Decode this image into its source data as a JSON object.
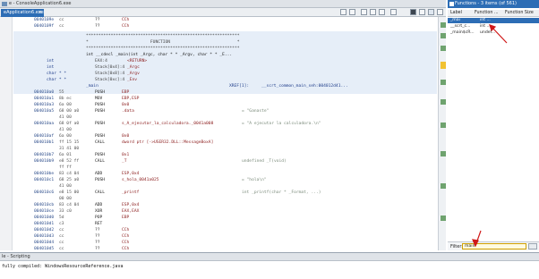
{
  "listing": {
    "title": "e - ConsoleApplication6.exe",
    "tab_label": "eApplication6.exe",
    "tab_close": "×",
    "lines": [
      {
        "addr": "0040109e",
        "bytes": "cc",
        "mn": "??",
        "op": "CCh",
        "cmt": ""
      },
      {
        "addr": "0040109f",
        "bytes": "cc",
        "mn": "??",
        "op": "CCh",
        "cmt": ""
      }
    ],
    "header_box": {
      "top_border": "**************************************************************",
      "function_line": "*                         FUNCTION                           *",
      "bottom_border": "**************************************************************",
      "signature": "int __cdecl _main(int _Argc, char * * _Argv, char * * _E...",
      "params": [
        {
          "type": "int",
          "loc": "EAX:4",
          "name": "<RETURN>"
        },
        {
          "type": "int",
          "loc": "Stack[0x4]:4",
          "name": "_Argc"
        },
        {
          "type": "char * *",
          "loc": "Stack[0x8]:4",
          "name": "_Argv"
        },
        {
          "type": "char * *",
          "loc": "Stack[0xc]:4",
          "name": "_Env"
        }
      ],
      "label": "_main",
      "xref": "XREF[1]:     __scrt_common_main_seh:004012d41..."
    },
    "body": [
      {
        "addr": "004010a0",
        "bytes": "55",
        "mn": "PUSH",
        "op": "EBP",
        "cmt": ""
      },
      {
        "addr": "004010a1",
        "bytes": "8b ec",
        "mn": "MOV",
        "op": "EBP,ESP",
        "cmt": ""
      },
      {
        "addr": "004010a3",
        "bytes": "6a 00",
        "mn": "PUSH",
        "op": "0x0",
        "cmt": ""
      },
      {
        "addr": "004010a5",
        "bytes": "68 00 a0",
        "mn": "PUSH",
        "op": ".data",
        "cmt": "= \"Ganaste\""
      },
      {
        "addr": "",
        "bytes": "41 00",
        "mn": "",
        "op": "",
        "cmt": ""
      },
      {
        "addr": "004010aa",
        "bytes": "68 0f a0",
        "mn": "PUSH",
        "op": "s_A_ejecutar_la_calculadora._0041a008",
        "cmt": "= \"A ejecutar la calculadora.\\n\""
      },
      {
        "addr": "",
        "bytes": "41 00",
        "mn": "",
        "op": "",
        "cmt": ""
      },
      {
        "addr": "004010af",
        "bytes": "6a 00",
        "mn": "PUSH",
        "op": "0x0",
        "cmt": ""
      },
      {
        "addr": "004010b1",
        "bytes": "ff 15 15",
        "mn": "CALL",
        "op": "dword ptr [->USER32.DLL::MessageBoxA]",
        "cmt": ""
      },
      {
        "addr": "",
        "bytes": "31 41 00",
        "mn": "",
        "op": "",
        "cmt": ""
      },
      {
        "addr": "004010b7",
        "bytes": "6a 01",
        "mn": "PUSH",
        "op": "0x1",
        "cmt": ""
      },
      {
        "addr": "004010b9",
        "bytes": "e8 52 ff",
        "mn": "CALL",
        "op": "_T",
        "cmt": "undefined _T(void)"
      },
      {
        "addr": "",
        "bytes": "ff ff",
        "mn": "",
        "op": "",
        "cmt": ""
      },
      {
        "addr": "004010be",
        "bytes": "83 c4 04",
        "mn": "ADD",
        "op": "ESP,0x4",
        "cmt": ""
      },
      {
        "addr": "004010c1",
        "bytes": "68 25 a0",
        "mn": "PUSH",
        "op": "s_hola_0041a025",
        "cmt": "= \"hola\\n\""
      },
      {
        "addr": "",
        "bytes": "41 00",
        "mn": "",
        "op": "",
        "cmt": ""
      },
      {
        "addr": "004010c6",
        "bytes": "e8 15 00",
        "mn": "CALL",
        "op": "_printf",
        "cmt": "int _printf(char * _Format, ...)"
      },
      {
        "addr": "",
        "bytes": "00 00",
        "mn": "",
        "op": "",
        "cmt": ""
      },
      {
        "addr": "004010cb",
        "bytes": "83 c4 04",
        "mn": "ADD",
        "op": "ESP,0x4",
        "cmt": ""
      },
      {
        "addr": "004010ce",
        "bytes": "33 c0",
        "mn": "XOR",
        "op": "EAX,EAX",
        "cmt": ""
      },
      {
        "addr": "004010d0",
        "bytes": "5d",
        "mn": "POP",
        "op": "EBP",
        "cmt": ""
      },
      {
        "addr": "004010d1",
        "bytes": "c3",
        "mn": "RET",
        "op": "",
        "cmt": ""
      },
      {
        "addr": "004010d2",
        "bytes": "cc",
        "mn": "??",
        "op": "CCh",
        "cmt": ""
      },
      {
        "addr": "004010d3",
        "bytes": "cc",
        "mn": "??",
        "op": "CCh",
        "cmt": ""
      },
      {
        "addr": "004010d4",
        "bytes": "cc",
        "mn": "??",
        "op": "CCh",
        "cmt": ""
      },
      {
        "addr": "004010d5",
        "bytes": "cc",
        "mn": "??",
        "op": "CCh",
        "cmt": ""
      }
    ]
  },
  "functions": {
    "title": "Functions - 3 items (of 561)",
    "columns": [
      "Label",
      "Function ...",
      "Function Size"
    ],
    "rows": [
      {
        "label": "_mai",
        "sig": "int ...",
        "selected": true
      },
      {
        "label": "__scrt_c...",
        "sig": "int ...",
        "selected": false
      },
      {
        "label": "_main$cR...",
        "sig": "undef...",
        "selected": false
      }
    ],
    "filter_label": "Filter:",
    "filter_value": "main"
  },
  "console": {
    "title": "le - Scripting",
    "message": "fully compiled: WindowsResourceReference.java"
  },
  "colors": {
    "accent": "#2d6db5",
    "annotation_arrow": "#d01818"
  }
}
